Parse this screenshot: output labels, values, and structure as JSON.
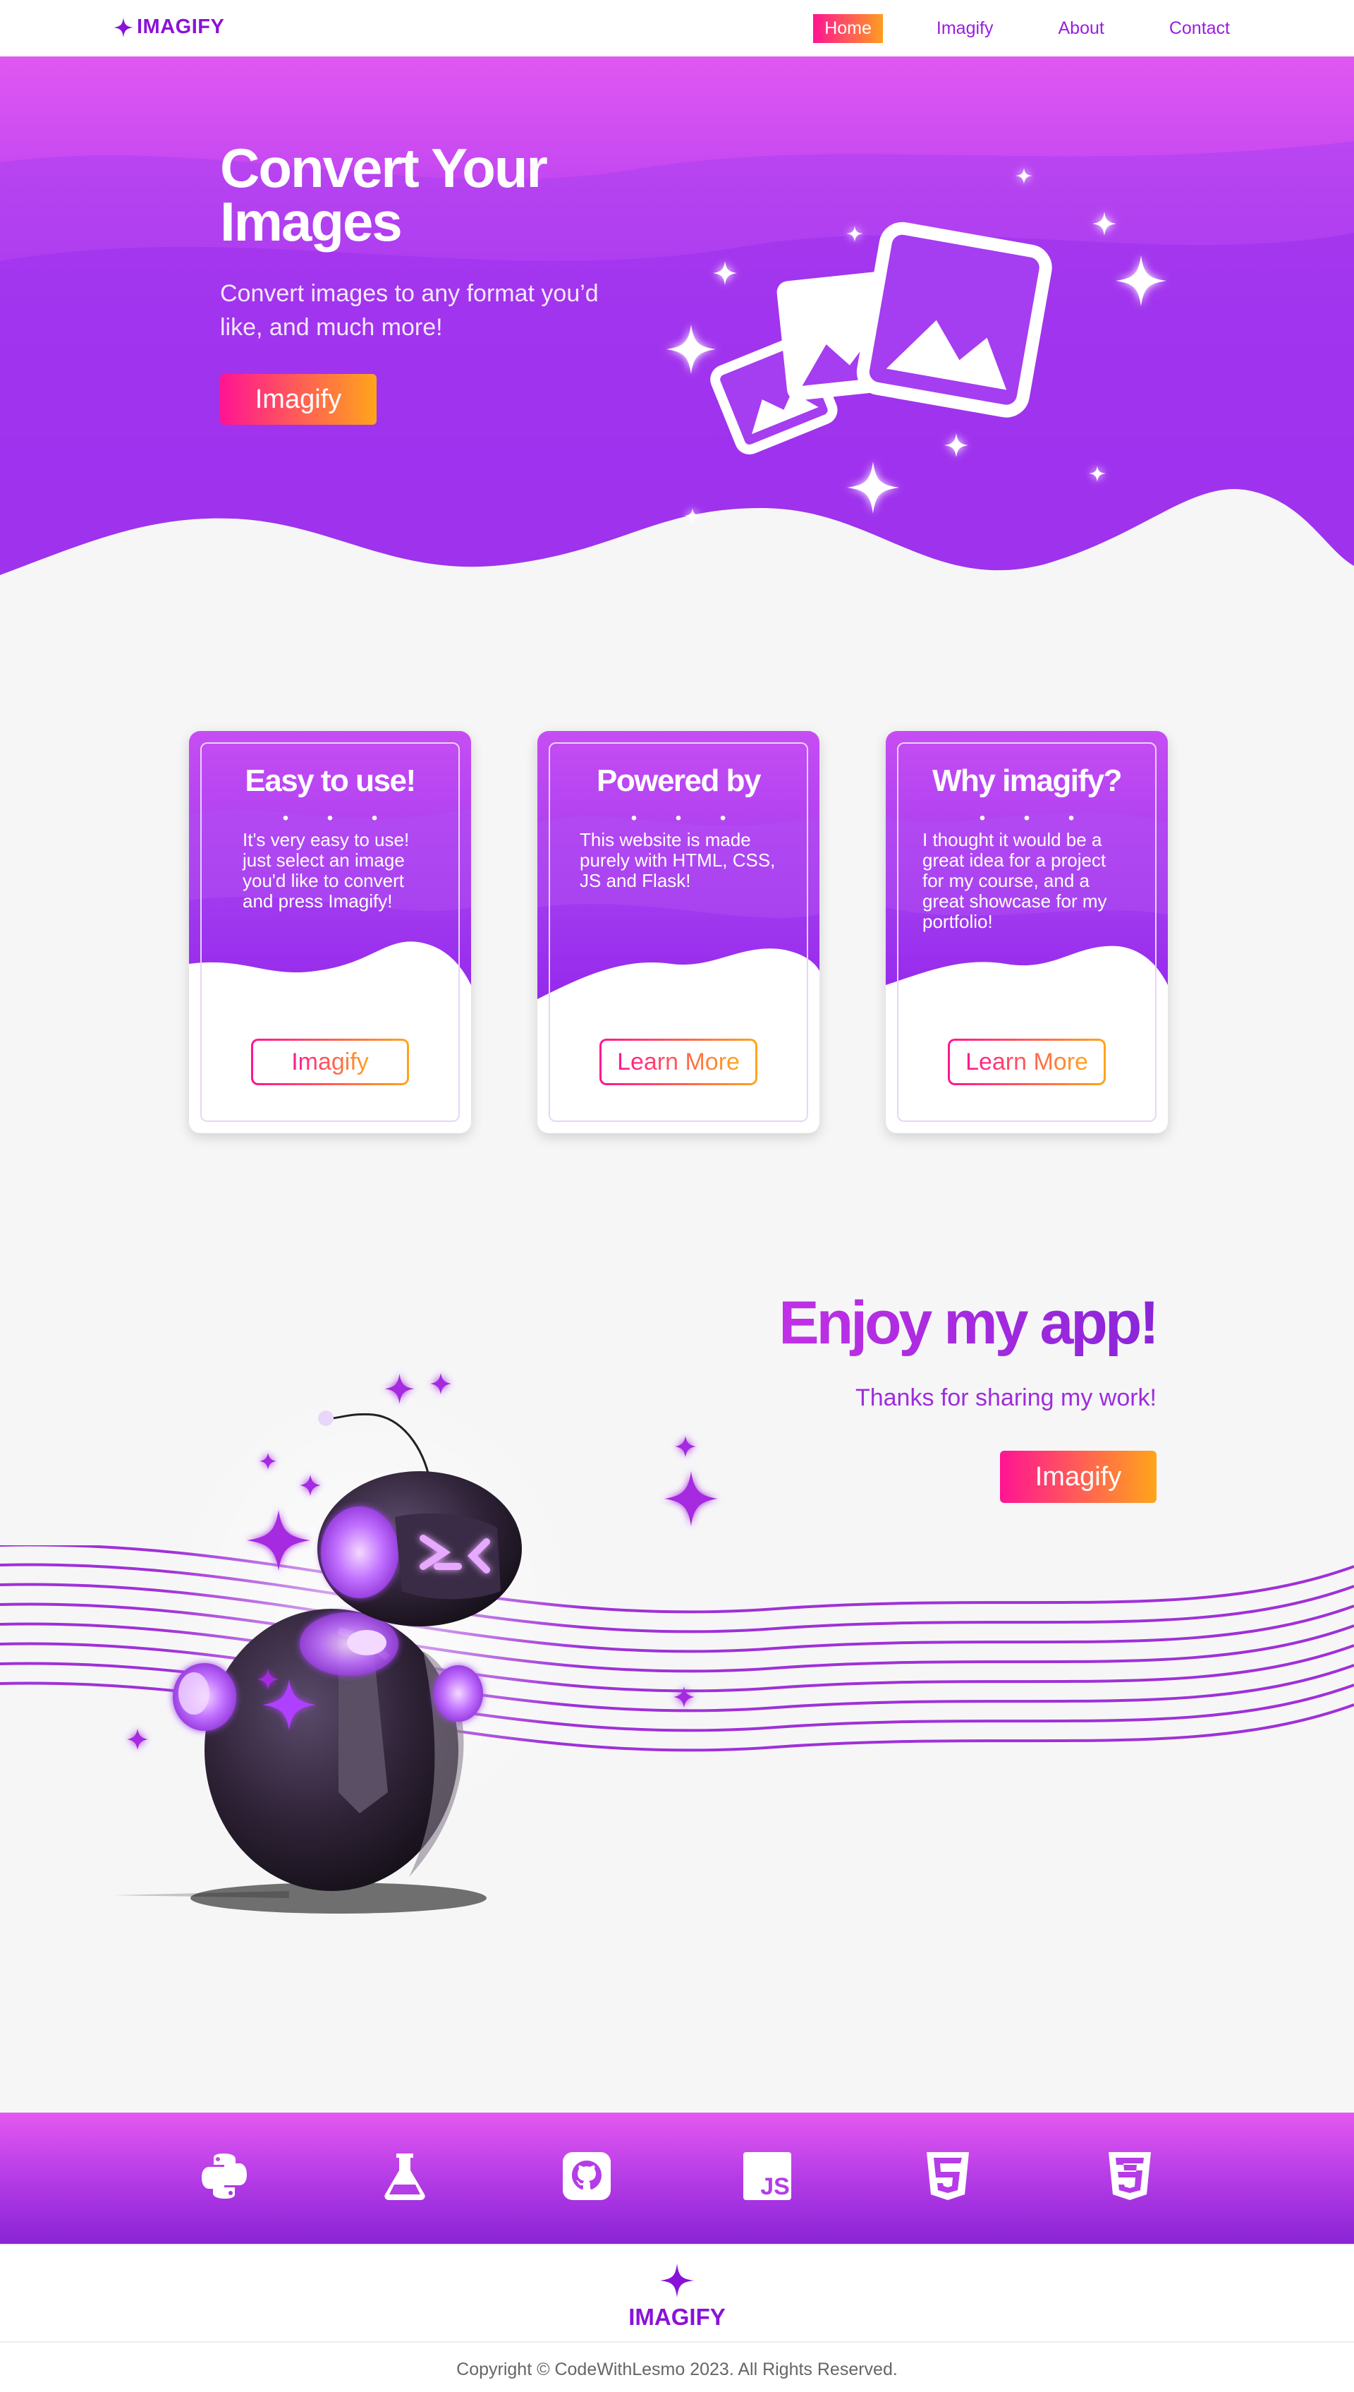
{
  "nav": {
    "logo": "IMAGIFY",
    "links": [
      {
        "label": "Home",
        "active": true
      },
      {
        "label": "Imagify",
        "active": false
      },
      {
        "label": "About",
        "active": false
      },
      {
        "label": "Contact",
        "active": false
      }
    ]
  },
  "hero": {
    "title": "Convert Your Images",
    "subtitle": "Convert images to any format you’d like, and much more!",
    "button": "Imagify"
  },
  "cards": [
    {
      "title": "Easy to use!",
      "dots": "• • •",
      "text": "It's very easy to use! just select an image you'd like to convert and press Imagify!",
      "button": "Imagify"
    },
    {
      "title": "Powered by",
      "dots": "• • •",
      "text": "This website is made purely with HTML, CSS, JS and Flask!",
      "button": "Learn More"
    },
    {
      "title": "Why imagify?",
      "dots": "• • •",
      "text": "I thought it would be a great idea for a project for my course, and a great showcase for my portfolio!",
      "button": "Learn More"
    }
  ],
  "enjoy": {
    "title": "Enjoy my app!",
    "subtitle": "Thanks for sharing my work!",
    "button": "Imagify"
  },
  "tech_icons": [
    "python-icon",
    "flask-icon",
    "github-icon",
    "javascript-icon",
    "html5-icon",
    "css3-icon"
  ],
  "js_badge": "JS",
  "html_badge": "5",
  "css_badge": "3",
  "footer": {
    "logo": "IMAGIFY",
    "copyright": "Copyright © CodeWithLesmo 2023. All Rights Reserved."
  },
  "colors": {
    "brand_purple": "#8a12d8",
    "gradient_start": "#ff1493",
    "gradient_end": "#ffa51a"
  }
}
